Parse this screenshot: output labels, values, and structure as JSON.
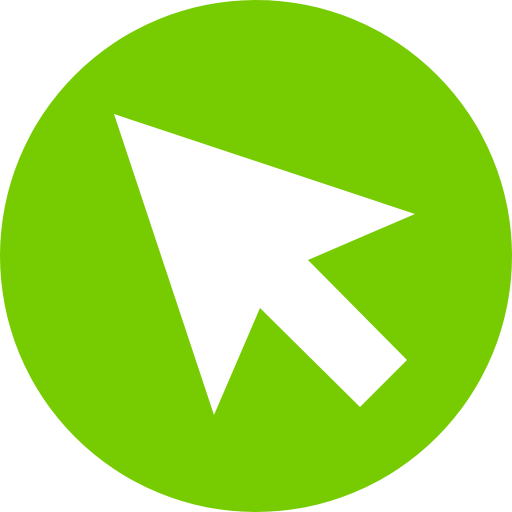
{
  "icon": {
    "name": "cursor-arrow-icon",
    "background_shape": "circle",
    "colors": {
      "circle": "#76CC00",
      "arrow": "#FFFFFF",
      "page_background": "#FFFFFF"
    }
  }
}
